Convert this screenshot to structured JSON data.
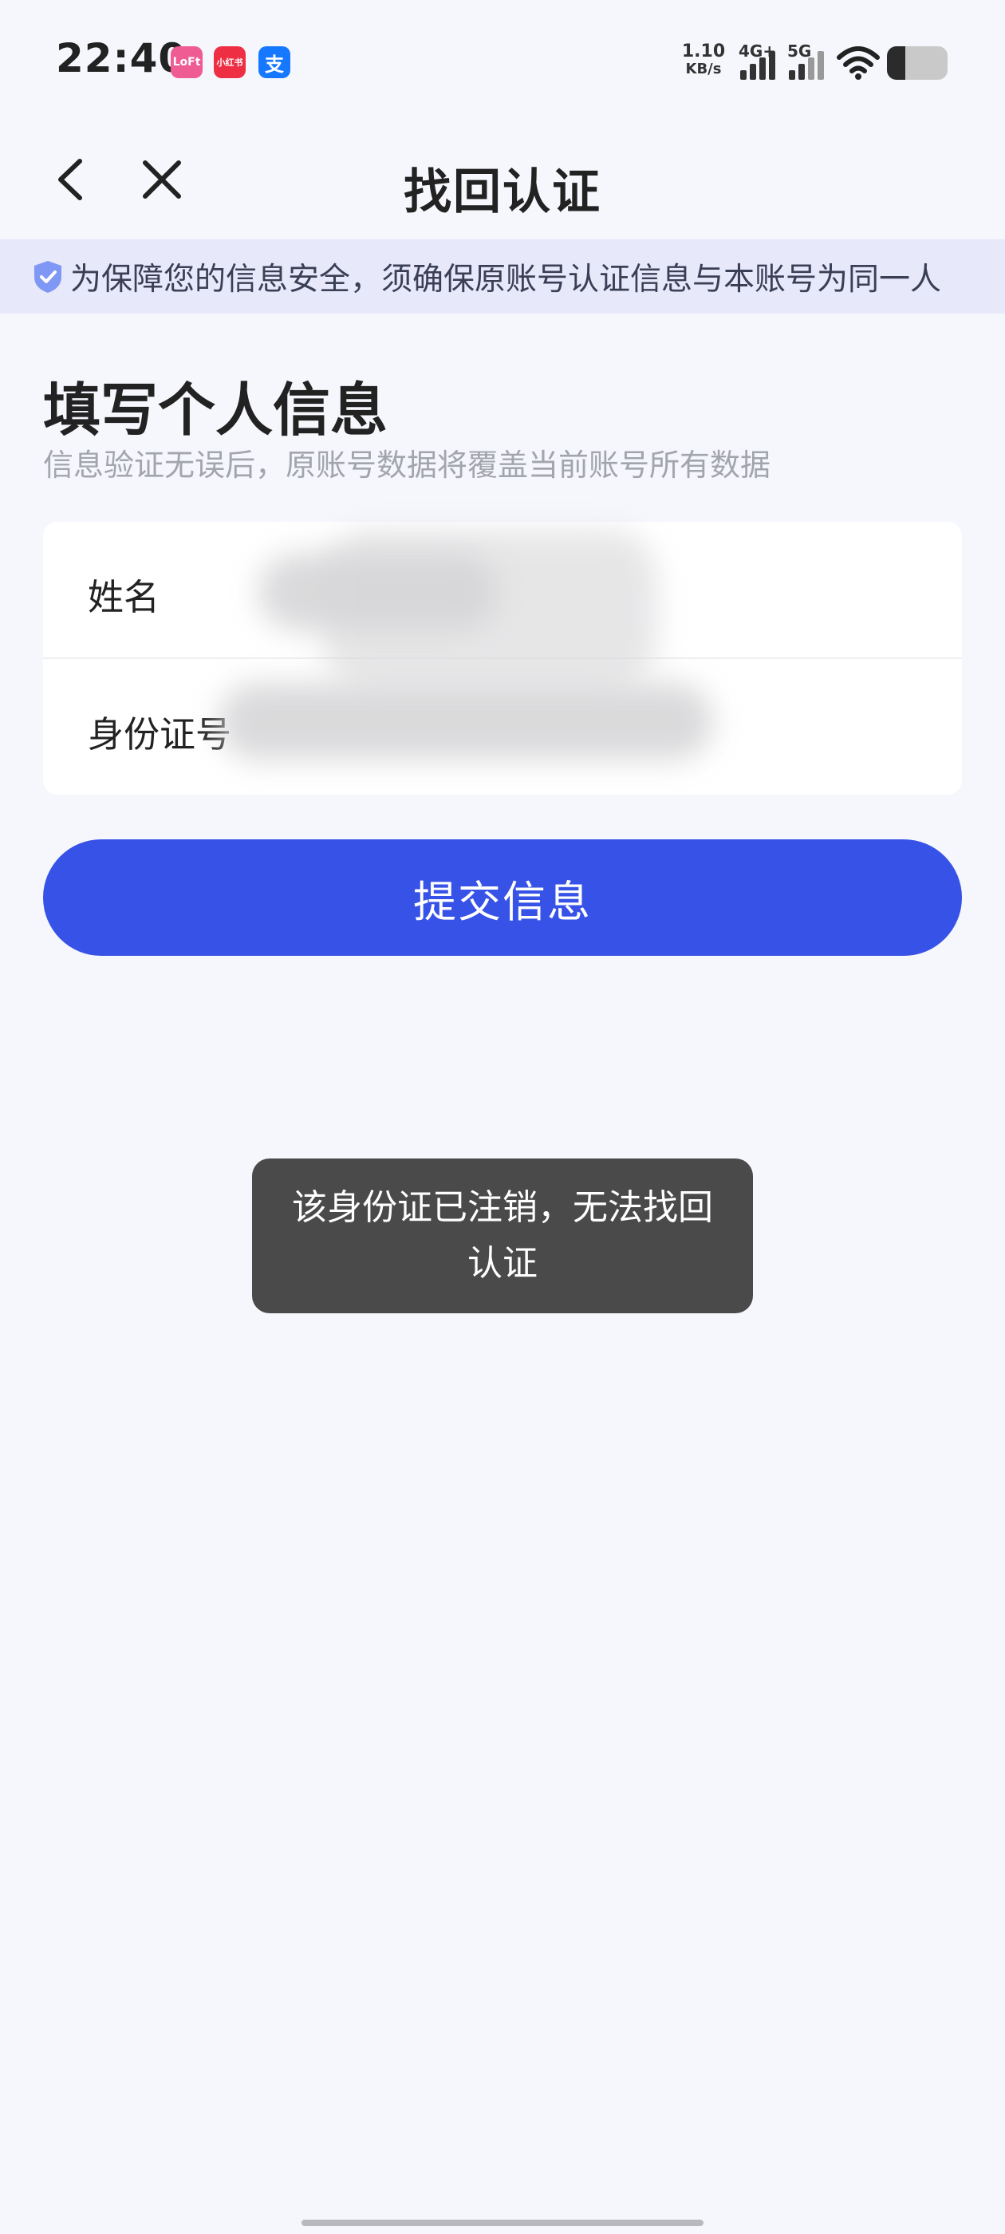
{
  "status_bar": {
    "time": "22:40",
    "app_icons": [
      {
        "name": "lofter-app-icon",
        "text": "LoFt"
      },
      {
        "name": "xiaohongshu-app-icon",
        "text": "小红书"
      },
      {
        "name": "alipay-app-icon",
        "text": "支"
      }
    ],
    "net_speed_value": "1.10",
    "net_speed_unit": "KB/s",
    "signal_1": "4G+",
    "signal_2": "5G",
    "battery_level": 0.3
  },
  "nav": {
    "title": "找回认证",
    "back_icon": "chevron-left-icon",
    "close_icon": "close-icon"
  },
  "notice": {
    "icon": "shield-check-icon",
    "text": "为保障您的信息安全，须确保原账号认证信息与本账号为同一人"
  },
  "section": {
    "title": "填写个人信息",
    "subtitle": "信息验证无误后，原账号数据将覆盖当前账号所有数据"
  },
  "form": {
    "name_label": "姓名",
    "name_value": "",
    "id_label": "身份证号",
    "id_value": ""
  },
  "submit_label": "提交信息",
  "toast": "该身份证已注销，无法找回认证",
  "colors": {
    "background": "#f6f7fd",
    "accent": "#3752e6",
    "notice_bg": "#e7e9fb",
    "toast_bg": "#4a4a4a"
  }
}
